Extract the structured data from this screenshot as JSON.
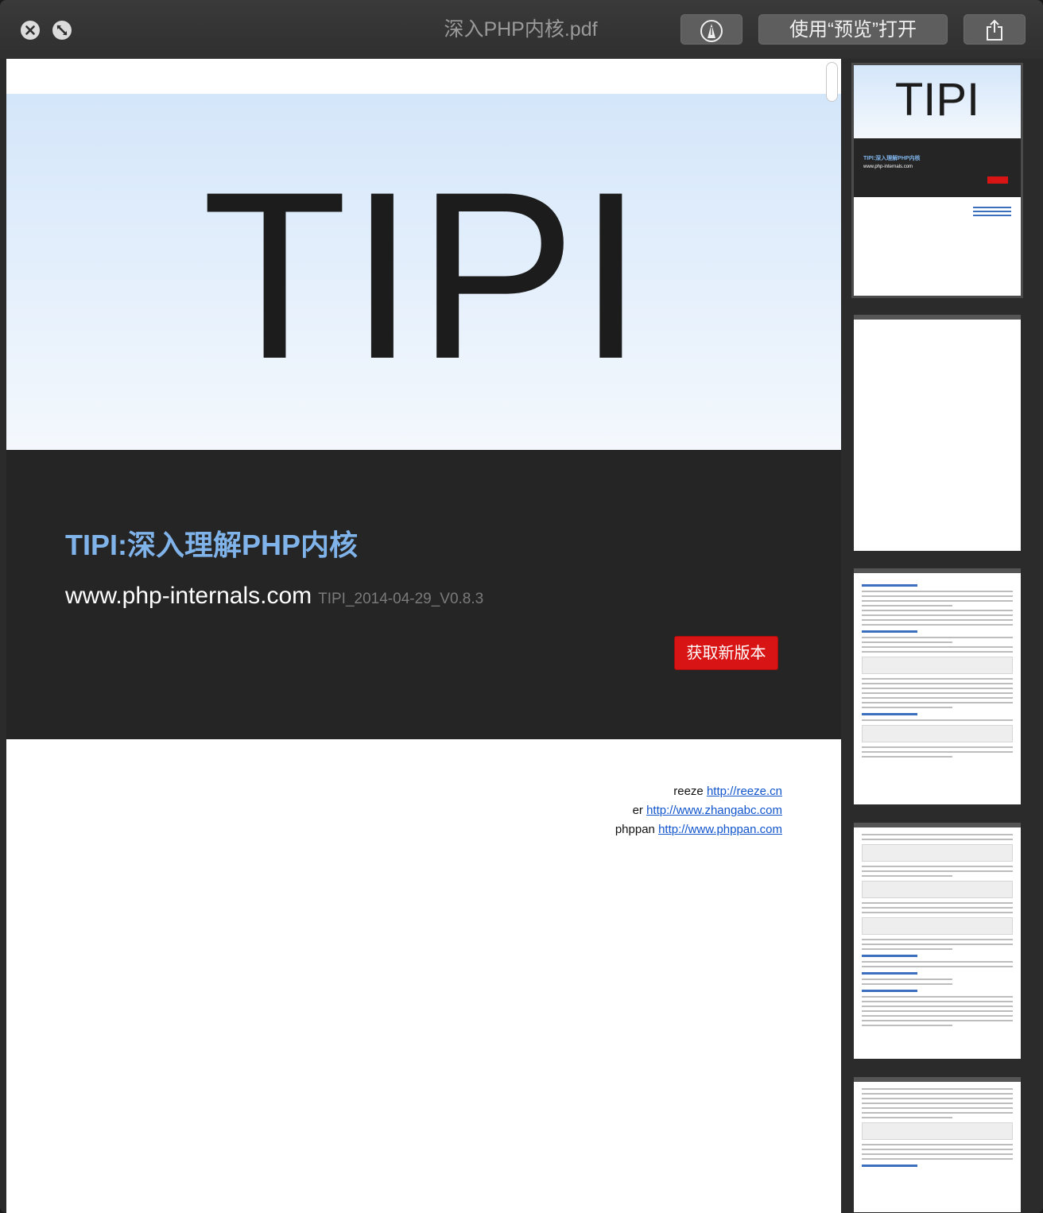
{
  "window": {
    "title": "深入PHP内核.pdf",
    "buttons": {
      "markup_icon": "markup-icon",
      "open_with_preview": "使用“预览”打开",
      "share_icon": "share-icon"
    }
  },
  "page": {
    "hero_title": "TIPI",
    "book_title": "TIPI:深入理解PHP内核",
    "site_url": "www.php-internals.com",
    "version": "TIPI_2014-04-29_V0.8.3",
    "get_new_button": "获取新版本",
    "authors": [
      {
        "name": "reeze",
        "url": "http://reeze.cn"
      },
      {
        "name": "er",
        "url": "http://www.zhangabc.com"
      },
      {
        "name": "phppan",
        "url": "http://www.phppan.com"
      }
    ]
  },
  "thumbnails": {
    "first": {
      "hero_title": "TIPI",
      "book_title": "TIPI:深入理解PHP内核",
      "site_url": "www.php-internals.com"
    }
  },
  "colors": {
    "accent_blue": "#7fb3ea",
    "red_button": "#d81414",
    "dark_band": "#252525"
  }
}
